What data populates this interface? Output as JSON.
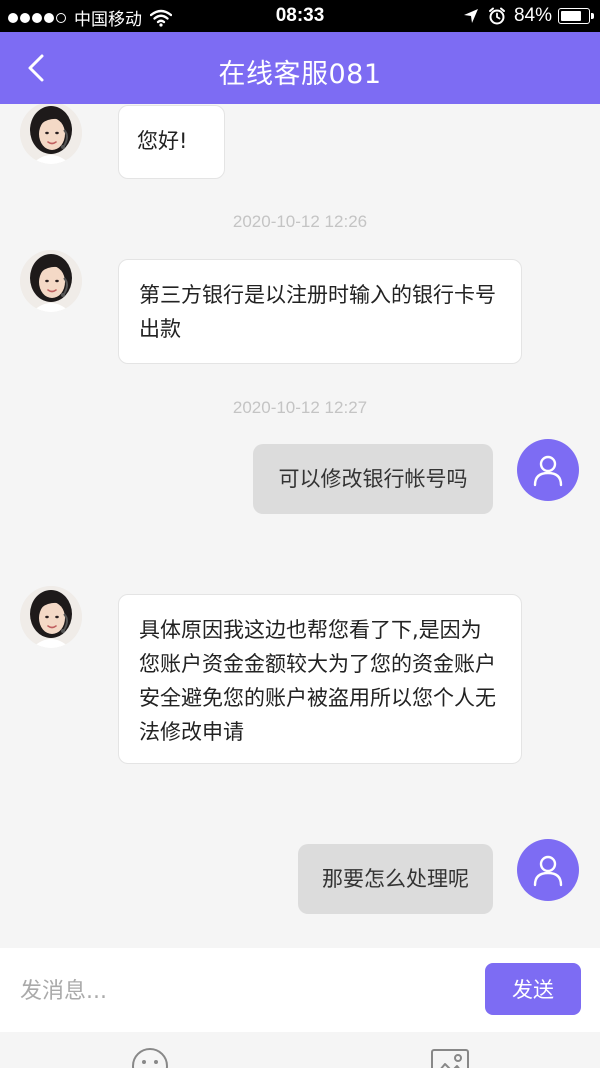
{
  "status_bar": {
    "carrier": "中国移动",
    "time": "08:33",
    "battery": "84%",
    "battery_level": 0.84,
    "icons": [
      "signal-dots",
      "wifi-icon",
      "location-arrow-icon",
      "alarm-icon",
      "battery-icon"
    ]
  },
  "nav": {
    "title": "在线客服081",
    "back_icon": "chevron-left-icon"
  },
  "colors": {
    "accent": "#7d6cf3",
    "background": "#f5f5f5",
    "user_bubble": "#dcdcdc",
    "agent_bubble": "#ffffff",
    "timestamp": "#c4c4c4"
  },
  "messages": [
    {
      "from": "agent",
      "text": "您好!"
    },
    {
      "type": "timestamp",
      "text": "2020-10-12 12:26"
    },
    {
      "from": "agent",
      "text": "第三方银行是以注册时输入的银行卡号出款"
    },
    {
      "type": "timestamp",
      "text": "2020-10-12 12:27"
    },
    {
      "from": "user",
      "text": "可以修改银行帐号吗"
    },
    {
      "from": "agent",
      "text": "具体原因我这边也帮您看了下,是因为您账户资金金额较大为了您的资金账户安全避免您的账户被盗用所以您个人无法修改申请"
    },
    {
      "from": "user",
      "text": "那要怎么处理呢"
    }
  ],
  "input": {
    "placeholder": "发消息...",
    "value": "",
    "send_label": "发送"
  },
  "toolbar": {
    "icons": [
      "emoji-icon",
      "image-icon"
    ]
  }
}
